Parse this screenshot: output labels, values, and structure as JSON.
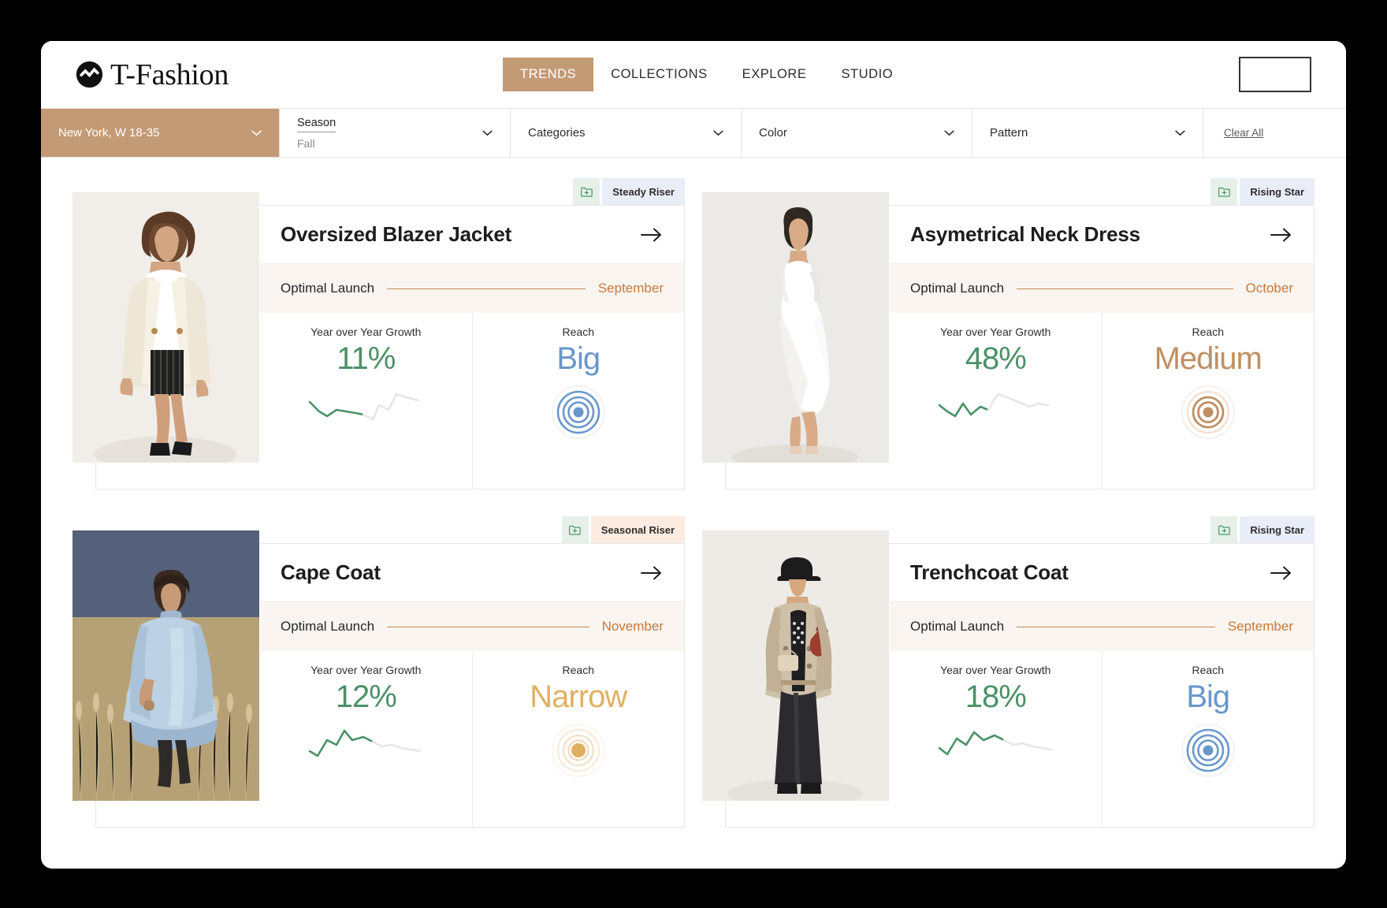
{
  "header": {
    "brand_name": "T-Fashion",
    "logo_icon": "wave-circle-logo",
    "nav": [
      {
        "label": "TRENDS",
        "active": true
      },
      {
        "label": "COLLECTIONS",
        "active": false
      },
      {
        "label": "EXPLORE",
        "active": false
      },
      {
        "label": "STUDIO",
        "active": false
      }
    ],
    "account_button_label": ""
  },
  "filters": {
    "location": {
      "label": "New York, W 18-35",
      "icon": "chevron-down-icon"
    },
    "season": {
      "label": "Season",
      "value": "Fall",
      "icon": "chevron-down-icon"
    },
    "categories": {
      "label": "Categories",
      "icon": "chevron-down-icon"
    },
    "color": {
      "label": "Color",
      "icon": "chevron-down-icon"
    },
    "pattern": {
      "label": "Pattern",
      "icon": "chevron-down-icon"
    },
    "clear_all": "Clear All"
  },
  "labels": {
    "optimal_launch": "Optimal Launch",
    "growth_label": "Year over Year Growth",
    "reach_label": "Reach",
    "save_icon": "folder-plus-icon",
    "arrow_icon": "arrow-right-icon",
    "target_icon": "concentric-target-icon",
    "spark_icon": "sparkline-icon"
  },
  "colors": {
    "accent_tan": "#c39a76",
    "launch_orange": "#c4793a",
    "growth_green": "#4b9168",
    "reach_big_blue": "#6a97ca",
    "reach_medium_tan": "#c08f63",
    "reach_narrow_gold": "#e0b062",
    "badge_green_bg": "#e6f0e8",
    "badge_blue_bg": "#e8edf7",
    "badge_peach_bg": "#fbebe1",
    "launch_row_bg": "#faf5f0"
  },
  "cards": [
    {
      "title": "Oversized Blazer Jacket",
      "badge": "Steady Riser",
      "badge_bg": "#e8edf7",
      "launch_month": "September",
      "growth": "11%",
      "reach": "Big",
      "reach_color": "#6a97ca",
      "reach_rings": 3,
      "photo_alt": "model-in-cream-oversized-blazer"
    },
    {
      "title": "Asymetrical Neck Dress",
      "badge": "Rising Star",
      "badge_bg": "#e8edf7",
      "launch_month": "October",
      "growth": "48%",
      "reach": "Medium",
      "reach_color": "#c08f63",
      "reach_rings": 2,
      "photo_alt": "model-in-white-asymmetrical-dress"
    },
    {
      "title": "Cape Coat",
      "badge": "Seasonal Riser",
      "badge_bg": "#fbebe1",
      "launch_month": "November",
      "growth": "12%",
      "reach": "Narrow",
      "reach_color": "#e0b062",
      "reach_rings": 0,
      "photo_alt": "model-in-light-blue-cape-coat-in-field"
    },
    {
      "title": "Trenchcoat Coat",
      "badge": "Rising Star",
      "badge_bg": "#e8edf7",
      "launch_month": "September",
      "growth": "18%",
      "reach": "Big",
      "reach_color": "#6a97ca",
      "reach_rings": 3,
      "photo_alt": "model-in-beige-trenchcoat-with-cap"
    }
  ],
  "chart_data": {
    "type": "line",
    "title": "Year over Year Growth sparklines",
    "series": [
      {
        "name": "Oversized Blazer Jacket actual",
        "values": [
          62,
          50,
          30,
          44,
          40,
          38,
          36
        ]
      },
      {
        "name": "Oversized Blazer Jacket forecast",
        "values": [
          36,
          26,
          48,
          40,
          70,
          62,
          58
        ]
      },
      {
        "name": "Asymetrical Neck Dress actual",
        "values": [
          55,
          42,
          30,
          56,
          34,
          50,
          46
        ]
      },
      {
        "name": "Asymetrical Neck Dress forecast",
        "values": [
          46,
          70,
          64,
          58,
          50,
          54,
          52
        ]
      },
      {
        "name": "Cape Coat actual",
        "values": [
          36,
          28,
          52,
          46,
          70,
          58,
          62
        ]
      },
      {
        "name": "Cape Coat forecast",
        "values": [
          62,
          54,
          48,
          50,
          46,
          44,
          42
        ]
      },
      {
        "name": "Trenchcoat Coat actual",
        "values": [
          40,
          30,
          56,
          46,
          68,
          60,
          64
        ]
      },
      {
        "name": "Trenchcoat Coat forecast",
        "values": [
          64,
          56,
          50,
          52,
          48,
          46,
          44
        ]
      }
    ],
    "xlabel": "",
    "ylabel": "",
    "grid": false,
    "legend": "none"
  }
}
